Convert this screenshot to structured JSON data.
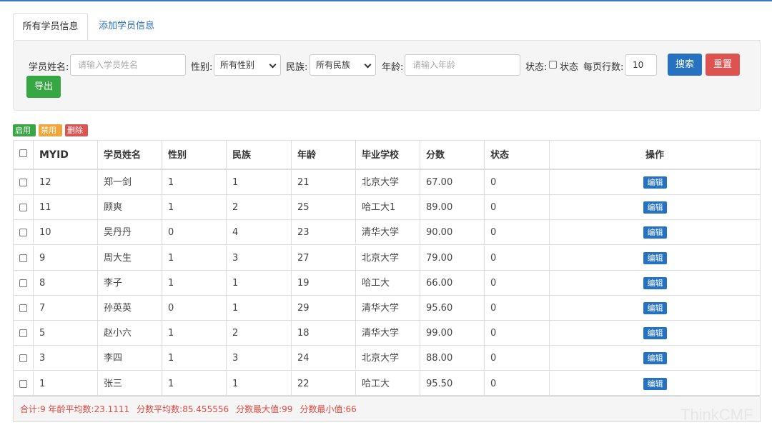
{
  "tabs": [
    {
      "label": "所有学员信息",
      "active": true
    },
    {
      "label": "添加学员信息",
      "active": false
    }
  ],
  "filters": {
    "name_label": "学员姓名:",
    "name_placeholder": "请输入学员姓名",
    "gender_label": "性别:",
    "gender_value": "所有性别",
    "nation_label": "民族:",
    "nation_value": "所有民族",
    "age_label": "年龄:",
    "age_placeholder": "请输入年龄",
    "status_label": "状态:",
    "status_checkbox_label": "状态",
    "rows_label": "每页行数:",
    "rows_value": "10",
    "search_button": "搜索",
    "reset_button": "重置",
    "export_button": "导出"
  },
  "bulk_actions": {
    "enable": "启用",
    "disable": "禁用",
    "delete": "删除"
  },
  "table": {
    "columns": [
      "MYID",
      "学员姓名",
      "性别",
      "民族",
      "年龄",
      "毕业学校",
      "分数",
      "状态",
      "操作"
    ],
    "edit_label": "编辑",
    "rows": [
      [
        "12",
        "郑一剑",
        "1",
        "1",
        "21",
        "北京大学",
        "67.00",
        "0"
      ],
      [
        "11",
        "顾爽",
        "1",
        "2",
        "25",
        "哈工大1",
        "89.00",
        "0"
      ],
      [
        "10",
        "吴丹丹",
        "0",
        "4",
        "23",
        "清华大学",
        "90.00",
        "0"
      ],
      [
        "9",
        "周大生",
        "1",
        "3",
        "27",
        "北京大学",
        "79.00",
        "0"
      ],
      [
        "8",
        "李子",
        "1",
        "1",
        "19",
        "哈工大",
        "66.00",
        "0"
      ],
      [
        "7",
        "孙英英",
        "0",
        "1",
        "29",
        "清华大学",
        "95.60",
        "0"
      ],
      [
        "5",
        "赵小六",
        "1",
        "2",
        "18",
        "清华大学",
        "99.00",
        "0"
      ],
      [
        "3",
        "李四",
        "1",
        "3",
        "24",
        "北京大学",
        "88.00",
        "0"
      ],
      [
        "1",
        "张三",
        "1",
        "1",
        "22",
        "哈工大",
        "95.50",
        "0"
      ]
    ]
  },
  "summary": {
    "total": "合计:9 年龄平均数:23.1111",
    "avg_score": "分数平均数:85.455556",
    "max_score": "分数最大值:99",
    "min_score": "分数最小值:66"
  },
  "watermark": "ThinkCMF",
  "colors": {
    "primary": "#2672c0",
    "danger": "#dd5350",
    "success": "#36a743",
    "warning": "#f0a63a",
    "summary_text": "#e0493f"
  }
}
